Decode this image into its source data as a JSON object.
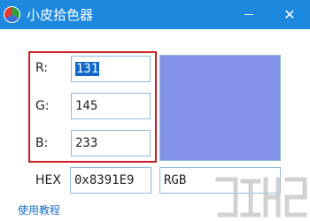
{
  "window": {
    "title": "小皮拾色器",
    "minimize_glyph": "—",
    "close_glyph": "✕"
  },
  "color_fields": [
    {
      "label": "R:",
      "value": "131"
    },
    {
      "label": "G:",
      "value": "145"
    },
    {
      "label": "B:",
      "value": "233"
    }
  ],
  "hex": {
    "label": "HEX",
    "value": "0x8391E9"
  },
  "rgb_field": {
    "value": "RGB"
  },
  "preview": {
    "color": "#8391e9"
  },
  "footer": {
    "help_link": "使用教程"
  },
  "colors": {
    "titlebar": "#1c88de",
    "highlight_box": "#cc1e24",
    "field_border": "#8fb9dc",
    "link": "#1a6ec0"
  }
}
